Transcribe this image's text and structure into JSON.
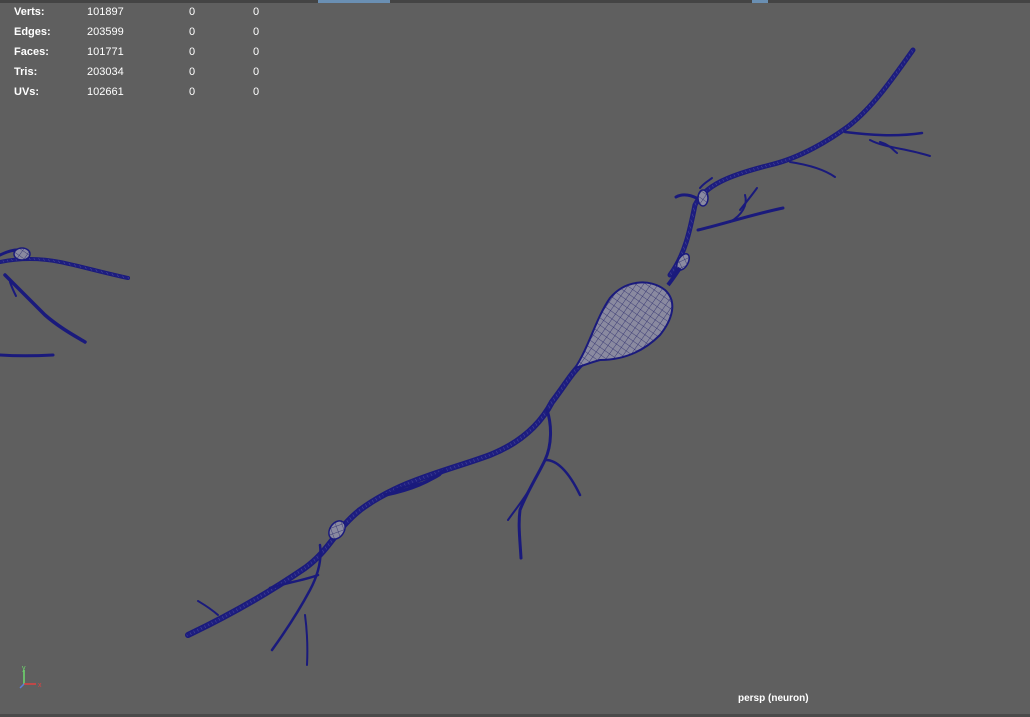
{
  "viewport": {
    "camera_label": "persp (neuron)",
    "background_color": "#5f5f5f",
    "mesh_color": "#1a1a7a"
  },
  "hud": {
    "rows": [
      {
        "label": "Verts:",
        "count": "101897",
        "selected": "0",
        "uv_selected": "0"
      },
      {
        "label": "Edges:",
        "count": "203599",
        "selected": "0",
        "uv_selected": "0"
      },
      {
        "label": "Faces:",
        "count": "101771",
        "selected": "0",
        "uv_selected": "0"
      },
      {
        "label": "Tris:",
        "count": "203034",
        "selected": "0",
        "uv_selected": "0"
      },
      {
        "label": "UVs:",
        "count": "102661",
        "selected": "0",
        "uv_selected": "0"
      }
    ]
  },
  "axis_gizmo": {
    "y_label": "y",
    "x_label": "x",
    "y_color": "#6fdc6f",
    "x_color": "#e04040"
  }
}
